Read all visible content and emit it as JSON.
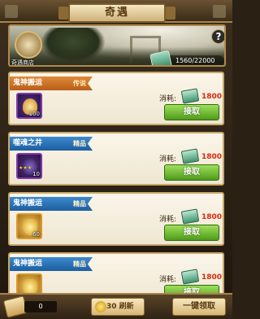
{
  "header": {
    "title": "奇遇"
  },
  "banner": {
    "qi_label": "奇遇商店",
    "help": "?",
    "stock": "1560/22000"
  },
  "cards": [
    {
      "name": "鬼神搬运",
      "grade": "传说",
      "ribbon_color": "#c46a20",
      "item_icon": "potion-flask-icon",
      "item_count": "100",
      "stars": "",
      "cost_label": "消耗:",
      "cost": "1800",
      "button": "接取"
    },
    {
      "name": "噬魂之井",
      "grade": "精品",
      "ribbon_color": "#2a70b8",
      "item_icon": "dark-beast-icon",
      "item_count": "10",
      "stars": "★★★",
      "cost_label": "消耗:",
      "cost": "1800",
      "button": "接取"
    },
    {
      "name": "鬼神搬运",
      "grade": "精品",
      "ribbon_color": "#2a70b8",
      "item_icon": "gold-ingot-icon",
      "item_count": "60",
      "stars": "",
      "cost_label": "消耗:",
      "cost": "1800",
      "button": "接取"
    },
    {
      "name": "鬼神搬运",
      "grade": "精品",
      "ribbon_color": "#2a70b8",
      "item_icon": "gold-ingot-icon",
      "item_count": "",
      "stars": "",
      "cost_label": "消耗:",
      "cost": "1800",
      "button": "接取"
    }
  ],
  "footer": {
    "token_count": "0",
    "refresh_label": "30 刷新",
    "claim_all_label": "一键领取"
  },
  "colors": {
    "cost_red": "#d42a10",
    "claim_green": "#5fae26"
  }
}
